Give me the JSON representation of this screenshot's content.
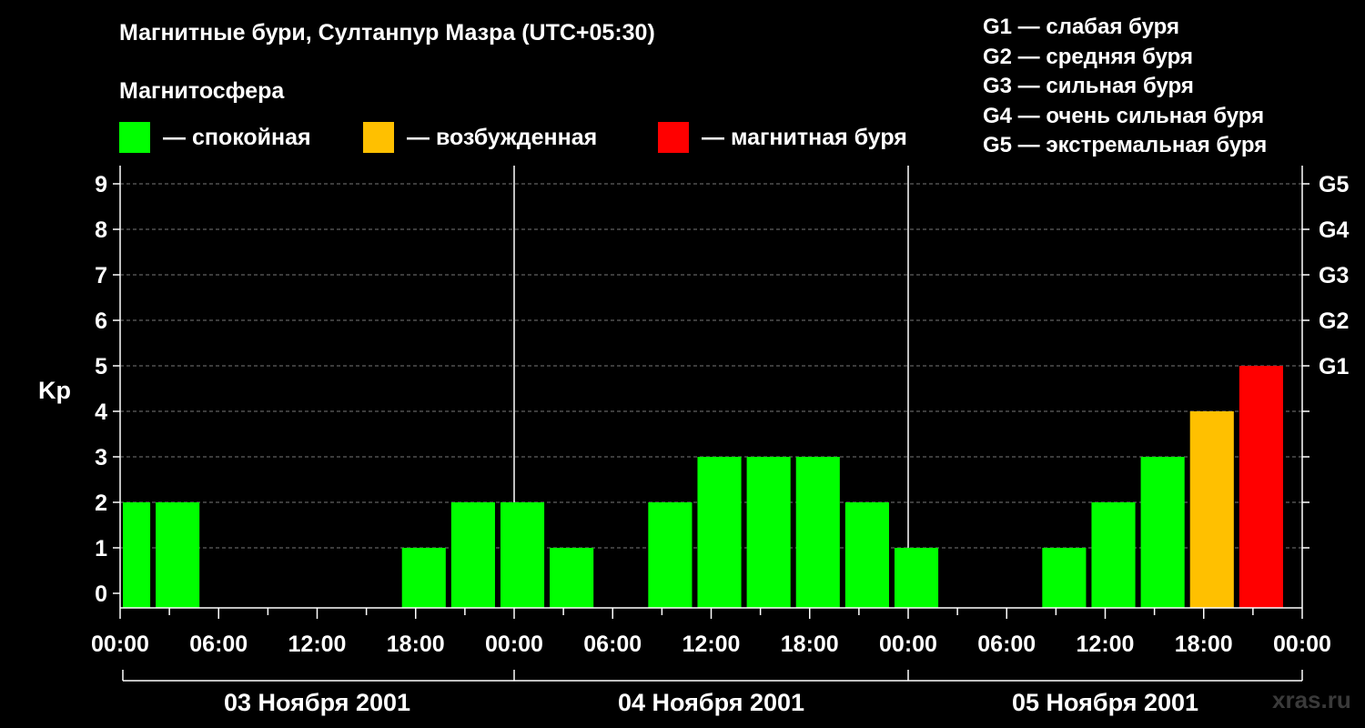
{
  "header": {
    "title": "Магнитные бури, Султанпур Мазра (UTC+05:30)",
    "subtitle": "Магнитосфера"
  },
  "legend": [
    {
      "color": "#00ff00",
      "label": "— спокойная"
    },
    {
      "color": "#ffc000",
      "label": "— возбужденная"
    },
    {
      "color": "#ff0000",
      "label": "— магнитная буря"
    }
  ],
  "g_levels": [
    "G1 — слабая буря",
    "G2 — средняя буря",
    "G3 — сильная буря",
    "G4 — очень сильная буря",
    "G5 — экстремальная буря"
  ],
  "watermark": "xras.ru",
  "chart_data": {
    "type": "bar",
    "ylabel": "Kp",
    "ylim": [
      0,
      9
    ],
    "yticks": [
      0,
      1,
      2,
      3,
      4,
      5,
      6,
      7,
      8,
      9
    ],
    "right_ticks": [
      {
        "value": 5,
        "label": "G1"
      },
      {
        "value": 6,
        "label": "G2"
      },
      {
        "value": 7,
        "label": "G3"
      },
      {
        "value": 8,
        "label": "G4"
      },
      {
        "value": 9,
        "label": "G5"
      }
    ],
    "x_hour_range": [
      0,
      72
    ],
    "x_tick_labels": [
      "00:00",
      "06:00",
      "12:00",
      "18:00",
      "00:00",
      "06:00",
      "12:00",
      "18:00",
      "00:00",
      "06:00",
      "12:00",
      "18:00",
      "00:00"
    ],
    "days": [
      "03 Ноября 2001",
      "04 Ноября 2001",
      "05 Ноября 2001"
    ],
    "bars": [
      {
        "start": 0,
        "end": 2,
        "kp": 2,
        "level": "quiet"
      },
      {
        "start": 2,
        "end": 5,
        "kp": 2,
        "level": "quiet"
      },
      {
        "start": 5,
        "end": 8,
        "kp": 0,
        "level": "quiet"
      },
      {
        "start": 8,
        "end": 11,
        "kp": 0,
        "level": "quiet"
      },
      {
        "start": 11,
        "end": 14,
        "kp": 0,
        "level": "quiet"
      },
      {
        "start": 14,
        "end": 17,
        "kp": 0,
        "level": "quiet"
      },
      {
        "start": 17,
        "end": 20,
        "kp": 1,
        "level": "quiet"
      },
      {
        "start": 20,
        "end": 23,
        "kp": 2,
        "level": "quiet"
      },
      {
        "start": 23,
        "end": 26,
        "kp": 2,
        "level": "quiet"
      },
      {
        "start": 26,
        "end": 29,
        "kp": 1,
        "level": "quiet"
      },
      {
        "start": 29,
        "end": 32,
        "kp": 0,
        "level": "quiet"
      },
      {
        "start": 32,
        "end": 35,
        "kp": 2,
        "level": "quiet"
      },
      {
        "start": 35,
        "end": 38,
        "kp": 3,
        "level": "quiet"
      },
      {
        "start": 38,
        "end": 41,
        "kp": 3,
        "level": "quiet"
      },
      {
        "start": 41,
        "end": 44,
        "kp": 3,
        "level": "quiet"
      },
      {
        "start": 44,
        "end": 47,
        "kp": 2,
        "level": "quiet"
      },
      {
        "start": 47,
        "end": 50,
        "kp": 1,
        "level": "quiet"
      },
      {
        "start": 50,
        "end": 53,
        "kp": 0,
        "level": "quiet"
      },
      {
        "start": 53,
        "end": 56,
        "kp": 0,
        "level": "quiet"
      },
      {
        "start": 56,
        "end": 59,
        "kp": 1,
        "level": "quiet"
      },
      {
        "start": 59,
        "end": 62,
        "kp": 2,
        "level": "quiet"
      },
      {
        "start": 62,
        "end": 65,
        "kp": 3,
        "level": "quiet"
      },
      {
        "start": 65,
        "end": 68,
        "kp": 4,
        "level": "active"
      },
      {
        "start": 68,
        "end": 71,
        "kp": 5,
        "level": "storm"
      }
    ],
    "level_colors": {
      "quiet": "#00ff00",
      "active": "#ffc000",
      "storm": "#ff0000"
    },
    "grid": true
  }
}
